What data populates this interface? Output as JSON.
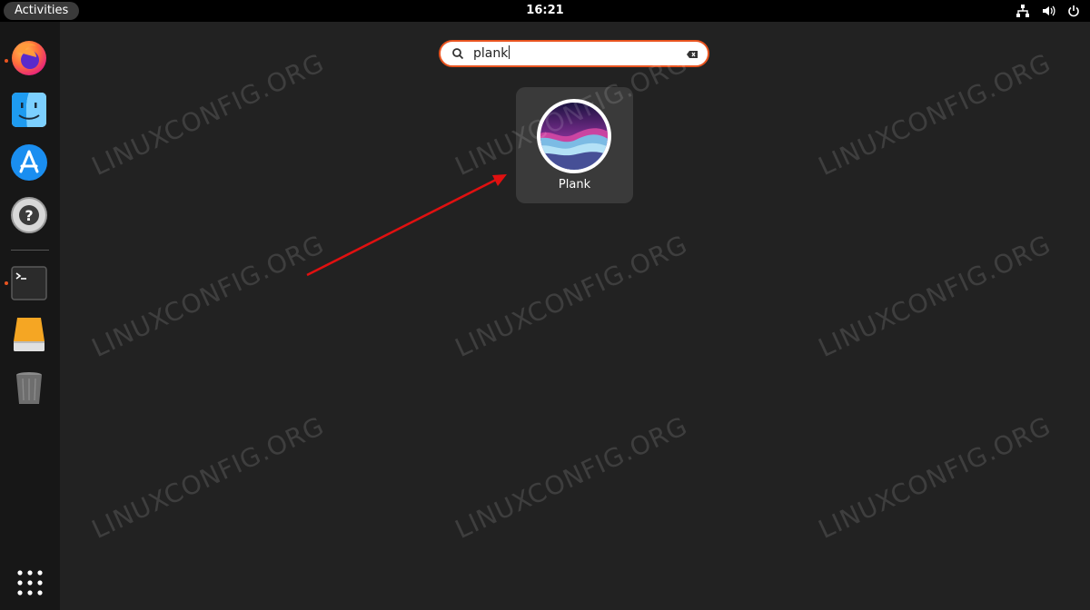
{
  "topbar": {
    "activities_label": "Activities",
    "clock": "16:21",
    "status_icons": [
      "network-icon",
      "volume-icon",
      "power-icon"
    ]
  },
  "dock": {
    "items": [
      {
        "name": "Firefox",
        "icon": "firefox-icon",
        "running": true
      },
      {
        "name": "Finder",
        "icon": "finder-face-icon",
        "running": false
      },
      {
        "name": "App Store",
        "icon": "app-store-icon",
        "running": false
      },
      {
        "name": "Help",
        "icon": "help-lifebuoy-icon",
        "running": false
      },
      {
        "name": "Terminal",
        "icon": "terminal-icon",
        "running": true
      },
      {
        "name": "Drive",
        "icon": "drive-icon",
        "running": false
      },
      {
        "name": "Trash",
        "icon": "trash-icon",
        "running": false
      }
    ],
    "show_apps_icon": "grid-icon"
  },
  "search": {
    "value": "plank"
  },
  "results": [
    {
      "label": "Plank",
      "icon": "plank-icon"
    }
  ],
  "watermark_text": "LINUXCONFIG.ORG",
  "colors": {
    "accent": "#e95420",
    "background": "#222222",
    "dock": "#171717",
    "arrow": "#e01010"
  }
}
